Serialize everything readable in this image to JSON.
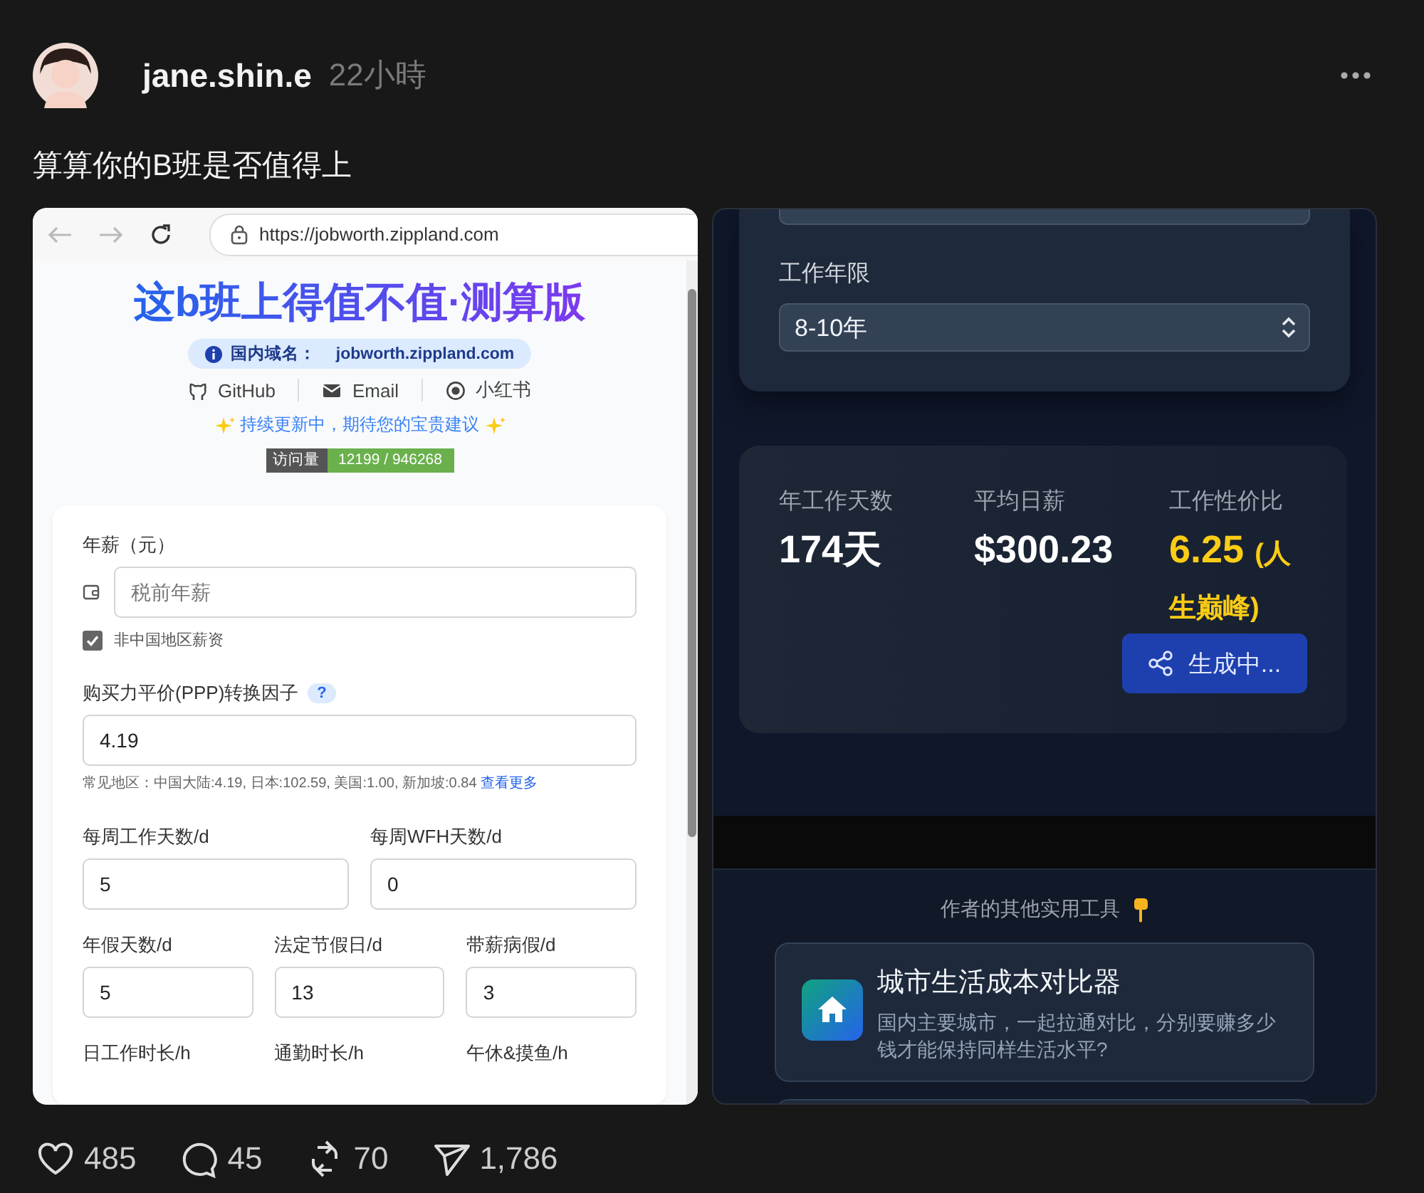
{
  "post": {
    "author": "jane.shin.e",
    "time": "22小時",
    "text": "算算你的B班是否值得上"
  },
  "left_screenshot": {
    "url": "https://jobworth.zippland.com",
    "title": "这b班上得值不值·测算版",
    "domain_label": "国内域名：",
    "domain": "jobworth.zippland.com",
    "links": [
      {
        "kind": "github",
        "label": "GitHub"
      },
      {
        "kind": "email",
        "label": "Email"
      },
      {
        "kind": "xiaohongshu",
        "label": "小红书"
      }
    ],
    "notice": "持续更新中，期待您的宝贵建议",
    "visits": {
      "label": "访问量",
      "value": "12199 / 946268"
    },
    "form": {
      "salary": {
        "label": "年薪（元）",
        "placeholder": "税前年薪"
      },
      "non_china": {
        "label": "非中国地区薪资",
        "checked": true
      },
      "ppp": {
        "label": "购买力平价(PPP)转换因子",
        "help": "?",
        "value": "4.19",
        "hint": "常见地区：中国大陆:4.19, 日本:102.59, 美国:1.00, 新加坡:0.84",
        "hint_link": "查看更多"
      },
      "rows": [
        [
          {
            "label": "每周工作天数/d",
            "value": "5"
          },
          {
            "label": "每周WFH天数/d",
            "value": "0"
          }
        ],
        [
          {
            "label": "年假天数/d",
            "value": "5"
          },
          {
            "label": "法定节假日/d",
            "value": "13"
          },
          {
            "label": "带薪病假/d",
            "value": "3"
          }
        ],
        [
          {
            "label": "日工作时长/h"
          },
          {
            "label": "通勤时长/h"
          },
          {
            "label": "午休&摸鱼/h"
          }
        ]
      ]
    }
  },
  "right_screenshot": {
    "experience": {
      "label": "工作年限",
      "value": "8-10年"
    },
    "results": [
      {
        "label": "年工作天数",
        "value": "174天",
        "highlight": false
      },
      {
        "label": "平均日薪",
        "value": "$300.23",
        "highlight": false
      },
      {
        "label": "工作性价比",
        "value": "6.25",
        "note": "(人生巅峰)",
        "highlight": true
      }
    ],
    "share_button": "生成中...",
    "tools_heading": "作者的其他实用工具",
    "tools": [
      {
        "title": "城市生活成本对比器",
        "description": "国内主要城市，一起拉通对比，分别要赚多少钱才能保持同样生活水平?"
      }
    ]
  },
  "actions": [
    {
      "kind": "like",
      "count": "485"
    },
    {
      "kind": "comment",
      "count": "45"
    },
    {
      "kind": "repost",
      "count": "70"
    },
    {
      "kind": "share",
      "count": "1,786"
    }
  ]
}
